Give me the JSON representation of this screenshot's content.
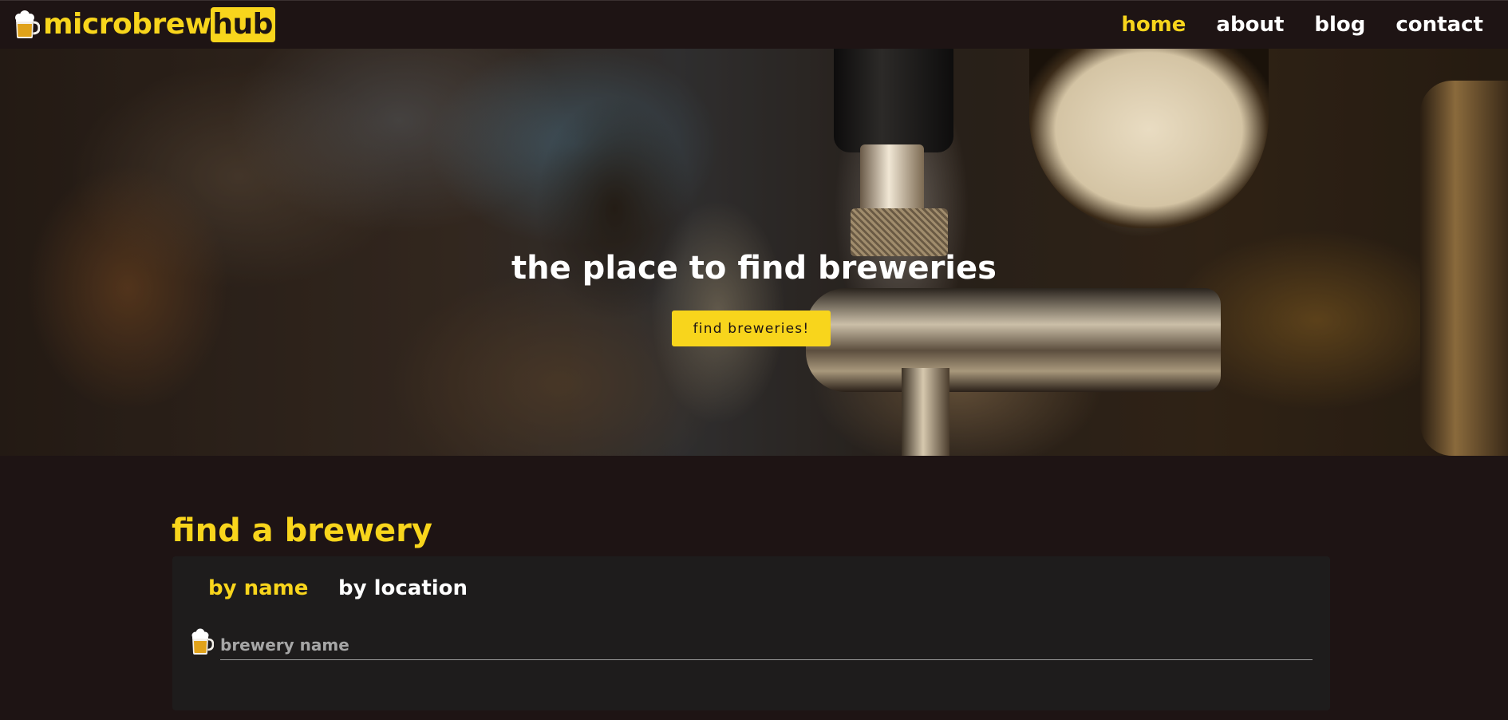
{
  "brand": {
    "main": "microbrew",
    "highlight": "hub",
    "logo_icon": "beer-mug-icon"
  },
  "nav": {
    "items": [
      {
        "label": "home",
        "active": true
      },
      {
        "label": "about",
        "active": false
      },
      {
        "label": "blog",
        "active": false
      },
      {
        "label": "contact",
        "active": false
      }
    ]
  },
  "hero": {
    "title": "the place to find breweries",
    "button_label": "find breweries!"
  },
  "find": {
    "title": "find a brewery",
    "tabs": [
      {
        "label": "by name",
        "active": true
      },
      {
        "label": "by location",
        "active": false
      }
    ],
    "input": {
      "placeholder": "brewery name",
      "value": "",
      "icon": "beer-mug-icon"
    }
  },
  "colors": {
    "accent": "#f8d51c",
    "background": "#1e1414",
    "card": "#1e1c1c",
    "text": "#ffffff"
  }
}
